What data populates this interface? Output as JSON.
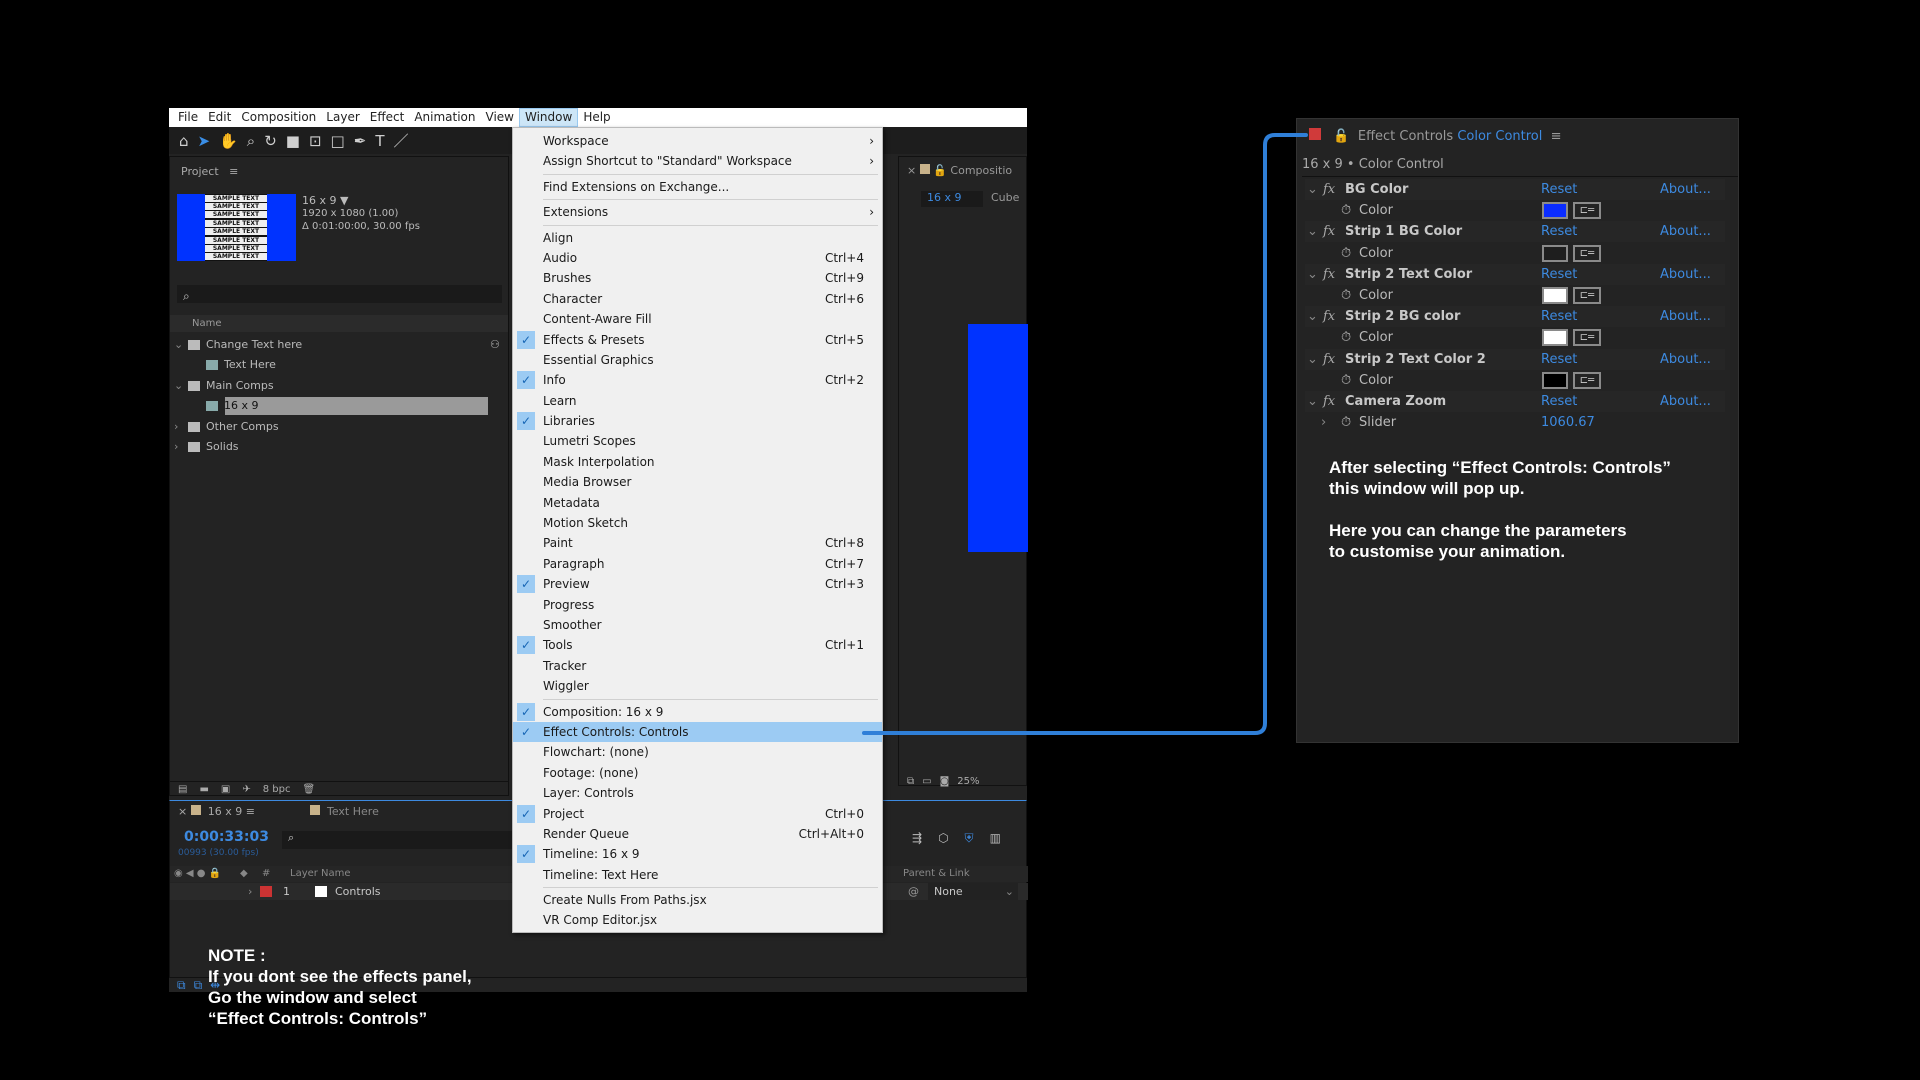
{
  "menubar": {
    "items": [
      "File",
      "Edit",
      "Composition",
      "Layer",
      "Effect",
      "Animation",
      "View",
      "Window",
      "Help"
    ],
    "active": "Window"
  },
  "project": {
    "title": "Project",
    "comp_name": "16 x 9 ▼",
    "comp_res": "1920 x 1080 (1.00)",
    "comp_dur": "Δ 0:01:00:00, 30.00 fps",
    "thumb_text": "SAMPLE TEXT",
    "search_icon": "⌕",
    "name_header": "Name",
    "tree": [
      {
        "label": "Change Text here",
        "type": "folder",
        "expanded": true
      },
      {
        "label": "Text Here",
        "type": "comp"
      },
      {
        "label": "Main Comps",
        "type": "folder",
        "expanded": true
      },
      {
        "label": "16 x 9",
        "type": "comp",
        "selected": true
      },
      {
        "label": "Other Comps",
        "type": "folder",
        "expanded": false
      },
      {
        "label": "Solids",
        "type": "folder",
        "expanded": false
      }
    ],
    "bpc": "8 bpc"
  },
  "composition": {
    "tab": "Compositio",
    "sub_active": "16 x 9",
    "sub_other": "Cube",
    "zoom": "25%",
    "preview_color": "#0033ff"
  },
  "timeline": {
    "tab1": "16 x 9",
    "tab2": "Text Here",
    "timecode": "0:00:33:03",
    "frames": "00993 (30.00 fps)",
    "col_num": "#",
    "col_layer": "Layer Name",
    "col_parent": "Parent & Link",
    "layer_num": "1",
    "layer_name": "Controls",
    "parent_value": "None"
  },
  "note": {
    "lines": [
      "NOTE :",
      "If you dont see the effects panel,",
      "Go the window and select",
      "“Effect Controls: Controls”"
    ]
  },
  "window_menu": {
    "groups": [
      [
        {
          "label": "Workspace",
          "submenu": true
        },
        {
          "label": "Assign Shortcut to \"Standard\" Workspace",
          "submenu": true
        }
      ],
      [
        {
          "label": "Find Extensions on Exchange..."
        }
      ],
      [
        {
          "label": "Extensions",
          "submenu": true
        }
      ],
      [
        {
          "label": "Align"
        },
        {
          "label": "Audio",
          "shortcut": "Ctrl+4"
        },
        {
          "label": "Brushes",
          "shortcut": "Ctrl+9"
        },
        {
          "label": "Character",
          "shortcut": "Ctrl+6"
        },
        {
          "label": "Content-Aware Fill"
        },
        {
          "label": "Effects & Presets",
          "shortcut": "Ctrl+5",
          "checked": true
        },
        {
          "label": "Essential Graphics"
        },
        {
          "label": "Info",
          "shortcut": "Ctrl+2",
          "checked": true
        },
        {
          "label": "Learn"
        },
        {
          "label": "Libraries",
          "checked": true
        },
        {
          "label": "Lumetri Scopes"
        },
        {
          "label": "Mask Interpolation"
        },
        {
          "label": "Media Browser"
        },
        {
          "label": "Metadata"
        },
        {
          "label": "Motion Sketch"
        },
        {
          "label": "Paint",
          "shortcut": "Ctrl+8"
        },
        {
          "label": "Paragraph",
          "shortcut": "Ctrl+7"
        },
        {
          "label": "Preview",
          "shortcut": "Ctrl+3",
          "checked": true
        },
        {
          "label": "Progress"
        },
        {
          "label": "Smoother"
        },
        {
          "label": "Tools",
          "shortcut": "Ctrl+1",
          "checked": true
        },
        {
          "label": "Tracker"
        },
        {
          "label": "Wiggler"
        }
      ],
      [
        {
          "label": "Composition: 16 x 9",
          "checked": true
        },
        {
          "label": "Effect Controls: Controls",
          "checked": true,
          "highlighted": true
        },
        {
          "label": "Flowchart: (none)"
        },
        {
          "label": "Footage: (none)"
        },
        {
          "label": "Layer: Controls"
        },
        {
          "label": "Project",
          "shortcut": "Ctrl+0",
          "checked": true
        },
        {
          "label": "Render Queue",
          "shortcut": "Ctrl+Alt+0"
        },
        {
          "label": "Timeline: 16 x 9",
          "checked": true
        },
        {
          "label": "Timeline: Text Here"
        }
      ],
      [
        {
          "label": "Create Nulls From Paths.jsx"
        },
        {
          "label": "VR Comp Editor.jsx"
        }
      ]
    ]
  },
  "effect_controls": {
    "title": "Effect Controls",
    "title_layer": "Color Control",
    "subtitle": "16 x 9 • Color Control",
    "reset": "Reset",
    "about": "About...",
    "effects": [
      {
        "name": "BG Color",
        "param": "Color",
        "color": "#0a2cff"
      },
      {
        "name": "Strip 1 BG Color",
        "param": "Color",
        "color": "#1e1e1e"
      },
      {
        "name": "Strip 2 Text Color",
        "param": "Color",
        "color": "#ffffff"
      },
      {
        "name": "Strip 2 BG color",
        "param": "Color",
        "color": "#ffffff"
      },
      {
        "name": "Strip 2 Text Color 2",
        "param": "Color",
        "color": "#000000"
      },
      {
        "name": "Camera Zoom",
        "param": "Slider",
        "value": "1060.67"
      }
    ]
  },
  "callout": {
    "lines": [
      "After selecting “Effect Controls: Controls”",
      "this window will pop up.",
      "",
      "Here you can change the parameters",
      "to customise your animation."
    ]
  },
  "colors": {
    "accent": "#3d8ae0",
    "connector": "#2f7fd8",
    "menu_highlight": "#9ccbf3"
  }
}
